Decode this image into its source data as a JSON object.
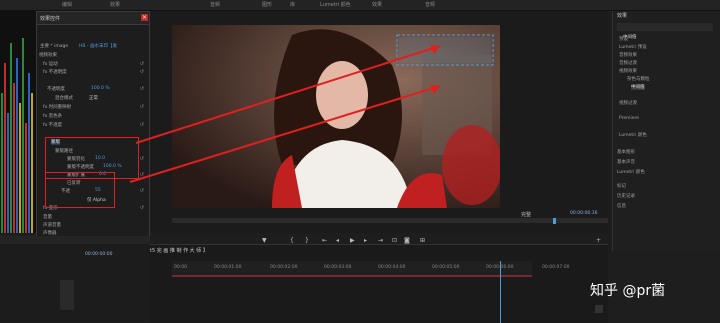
{
  "menu": {
    "items": [
      "编辑",
      "效果",
      "音频",
      "图形",
      "库",
      "Lumetri 颜色",
      "效果",
      "音频"
    ]
  },
  "effects_panel": {
    "title": "效果控件",
    "source_label": "主要 * image",
    "clip_label": "HB - 画水末印【发",
    "rows": [
      {
        "label": "视频效果"
      },
      {
        "label": "fx 运动"
      },
      {
        "label": "fx 不透明度"
      },
      {
        "label": "不透明度",
        "value": "100.0 %"
      },
      {
        "label": "混合模式",
        "value": "正常"
      },
      {
        "label": "fx 时间重映射"
      },
      {
        "label": "fx 黑色条"
      },
      {
        "label": "fx 不透度"
      },
      {
        "label": "蒙版"
      },
      {
        "label": "蒙版路径"
      },
      {
        "label": "蒙版羽化",
        "value": "10.0"
      },
      {
        "label": "蒙版不透明度",
        "value": "100.0 %"
      },
      {
        "label": "蒙版扩展",
        "value": "0.0"
      },
      {
        "label": "已反转"
      },
      {
        "label": "不透",
        "value": "55"
      },
      {
        "label": "Alpha",
        "value": "仅 Alpha"
      },
      {
        "label": "fx 变形"
      },
      {
        "label": "音量"
      },
      {
        "label": "声道音量"
      },
      {
        "label": "声像器"
      }
    ],
    "timecode": "00:00:00:00"
  },
  "monitor": {
    "fit_label": "完整",
    "timecode_right": "00:00:06:16",
    "timecode_left": "00:00:00:00",
    "title": "t5 完 画 推 制 作 大 师 】"
  },
  "project_panel": {
    "title": "效果",
    "items": [
      "中间值",
      "预设",
      "Lumetri 预设",
      "音频效果",
      "音频过渡",
      "视频效果",
      "杂色与颗粒",
      "中间值",
      "视频过渡",
      "Premiere",
      "Lumetri 颜色",
      "基本图形",
      "基本声音",
      "Lumetri 颜色",
      "标记",
      "历史记录",
      "信息"
    ]
  },
  "timeline": {
    "sequence_name": "t5 完 画 推 制 作 大 师 】",
    "ruler": [
      "00:00",
      "00:00:01:00",
      "00:00:02:00",
      "00:00:03:00",
      "00:00:04:00",
      "00:00:05:00",
      "00:00:06:00",
      "00:00:07:00"
    ]
  },
  "watermark": "知乎 @pr菌",
  "colors": {
    "accent": "#4a9ee0",
    "highlight_box": "#e02020",
    "arrow": "#e02020"
  }
}
